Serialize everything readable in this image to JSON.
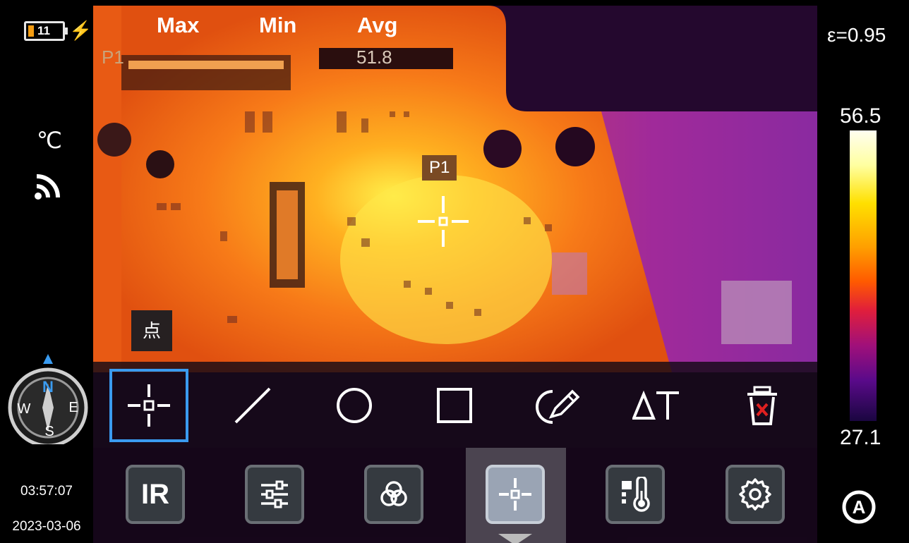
{
  "status": {
    "battery_level": "11",
    "temperature_unit": "℃",
    "time": "03:57:07",
    "date": "2023-03-06",
    "compass": {
      "n": "N",
      "e": "E",
      "s": "S",
      "w": "W"
    }
  },
  "readout": {
    "max_label": "Max",
    "min_label": "Min",
    "avg_label": "Avg",
    "point_name": "P1",
    "avg_value": "51.8"
  },
  "marker": {
    "label": "P1"
  },
  "tooltip": "点",
  "tools": [
    {
      "name": "point",
      "icon": "point-crosshair-icon",
      "selected": true
    },
    {
      "name": "line",
      "icon": "line-icon"
    },
    {
      "name": "circle",
      "icon": "circle-icon"
    },
    {
      "name": "rectangle",
      "icon": "rectangle-icon"
    },
    {
      "name": "freehand",
      "icon": "pen-icon"
    },
    {
      "name": "delta-temp",
      "icon": "delta-t-icon"
    },
    {
      "name": "delete",
      "icon": "trash-icon"
    }
  ],
  "menu": [
    {
      "name": "ir-mode",
      "label": "IR"
    },
    {
      "name": "adjust",
      "icon": "sliders-icon"
    },
    {
      "name": "palette",
      "icon": "palette-icon"
    },
    {
      "name": "measure",
      "icon": "crosshair-icon",
      "active": true
    },
    {
      "name": "temperature",
      "icon": "thermometer-icon"
    },
    {
      "name": "settings",
      "icon": "gear-icon"
    }
  ],
  "scale": {
    "emissivity": "ε=0.95",
    "max": "56.5",
    "min": "27.1",
    "auto_label": "A"
  },
  "colors": {
    "selection": "#3a9bf0",
    "delete_x": "#e02020"
  }
}
